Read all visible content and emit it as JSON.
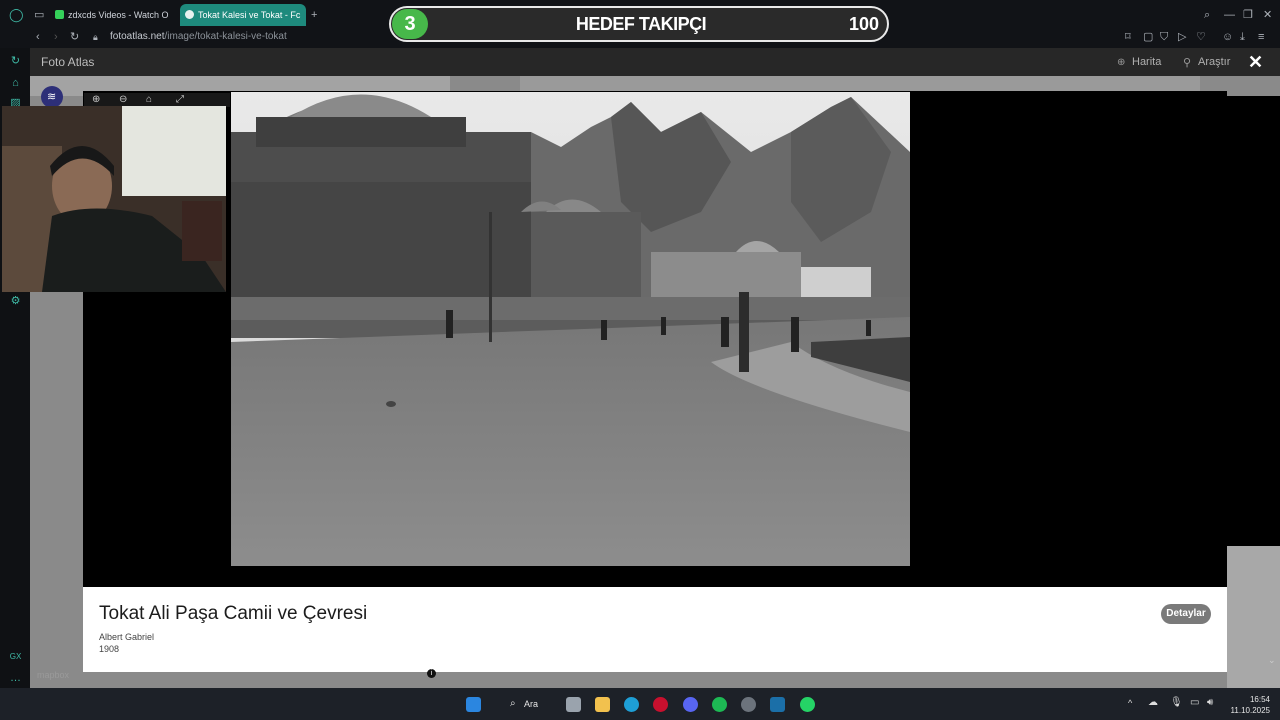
{
  "browser": {
    "tabs": [
      {
        "label": "zdxcds Videos - Watch O",
        "active": false
      },
      {
        "label": "Tokat Kalesi ve Tokat - Fc",
        "active": true
      }
    ],
    "new_tab": "+",
    "url_host": "fotoatlas.net",
    "url_path": "/image/tokat-kalesi-ve-tokat"
  },
  "overlay": {
    "level": "3",
    "title": "HEDEF TAKIPÇI",
    "count": "100"
  },
  "site": {
    "title": "Foto Atlas",
    "nav": {
      "map": "Harita",
      "research": "Araştır"
    },
    "close": "✕"
  },
  "photo": {
    "title": "Tokat Ali Paşa Camii ve Çevresi",
    "author": "Albert Gabriel",
    "year": "1908",
    "details_label": "Detaylar"
  },
  "map": {
    "attribution": "mapbox"
  },
  "taskbar": {
    "search_label": "Ara",
    "time": "16:54",
    "date": "11.10.2025"
  },
  "colors": {
    "accent": "#1e8a7d",
    "banner_green": "#47b84a",
    "sidebar_icon": "#3fbba7"
  }
}
